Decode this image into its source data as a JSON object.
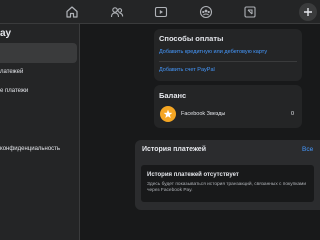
{
  "topbar": {
    "icons": [
      "home-icon",
      "friends-icon",
      "watch-icon",
      "groups-icon",
      "gaming-icon"
    ],
    "plus_icon": "plus-icon"
  },
  "sidebar": {
    "title": "ay",
    "items": [
      {
        "label": "",
        "active": true
      },
      {
        "label": "латежей",
        "active": false
      },
      {
        "label": "е платежи",
        "active": false
      },
      {
        "label": "конфиденциальность",
        "active": false
      }
    ]
  },
  "payment_methods": {
    "title": "Способы оплаты",
    "add_card_link": "Добавить кредитную или дебетовую карту",
    "add_paypal_link": "Добавить счет PayPal"
  },
  "balance": {
    "title": "Баланс",
    "item_label": "Facebook Звезды",
    "item_value": "0",
    "badge_icon": "star-icon",
    "badge_color": "#f5a623"
  },
  "history": {
    "title": "История платежей",
    "see_all": "Все",
    "empty_title": "История платежей отсутствует",
    "empty_desc": "Здесь будет показываться история транзакций, связанных с покупками через Facebook Pay."
  },
  "colors": {
    "background": "#18191a",
    "surface": "#242526",
    "link": "#4599ff"
  }
}
